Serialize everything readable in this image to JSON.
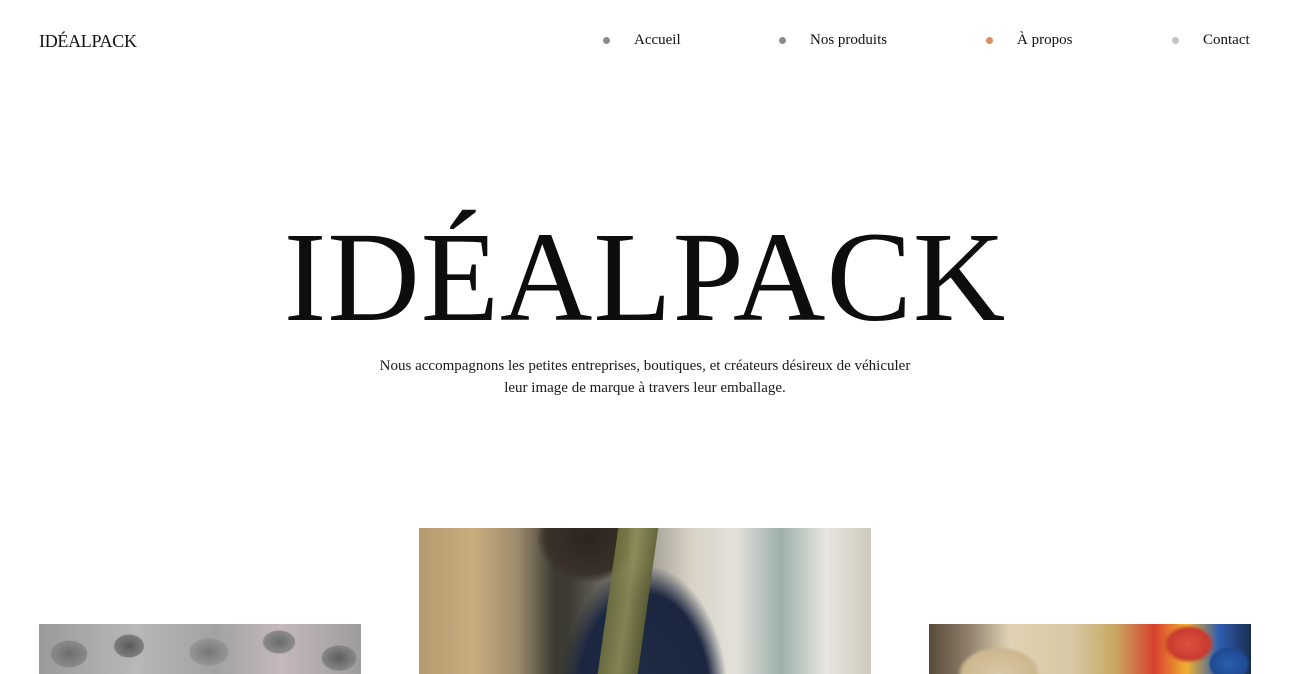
{
  "header": {
    "logo": "IDÉALPACK",
    "nav": [
      {
        "label": "Accueil",
        "dot_color": "#8a8a8a"
      },
      {
        "label": "Nos produits",
        "dot_color": "#8a8a8a"
      },
      {
        "label": "À propos",
        "dot_color": "#e0895a"
      },
      {
        "label": "Contact",
        "dot_color": "#c4c4c4"
      }
    ]
  },
  "hero": {
    "title": "IDÉALPACK",
    "subtitle_line1": "Nous accompagnons les petites entreprises, boutiques, et créateurs désireux de véhiculer",
    "subtitle_line2": "leur image de marque à travers leur emballage."
  },
  "colors": {
    "text": "#111111",
    "background": "#ffffff"
  }
}
